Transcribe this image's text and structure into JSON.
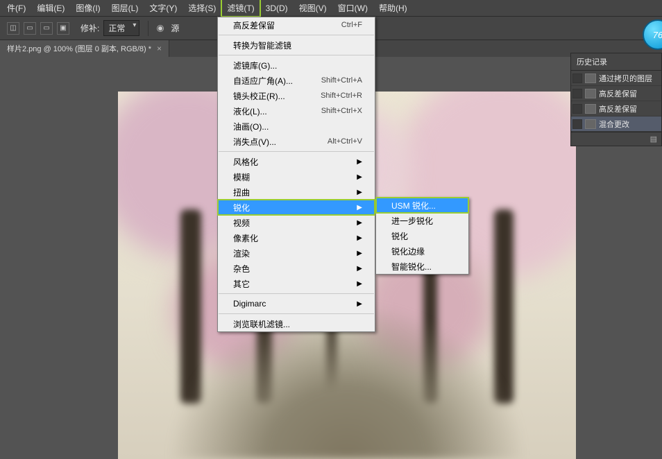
{
  "menubar": {
    "items": [
      {
        "label": "件(F)"
      },
      {
        "label": "编辑(E)"
      },
      {
        "label": "图像(I)"
      },
      {
        "label": "图层(L)"
      },
      {
        "label": "文字(Y)"
      },
      {
        "label": "选择(S)"
      },
      {
        "label": "滤镜(T)"
      },
      {
        "label": "3D(D)"
      },
      {
        "label": "视图(V)"
      },
      {
        "label": "窗口(W)"
      },
      {
        "label": "帮助(H)"
      }
    ],
    "active_index": 6
  },
  "optbar": {
    "label1": "修补:",
    "mode_value": "正常",
    "radio_label": "源"
  },
  "doc_tab": {
    "title": "样片2.png @ 100% (图层 0 副本, RGB/8) *"
  },
  "filter_menu": {
    "groups": [
      [
        {
          "label": "高反差保留",
          "shortcut": "Ctrl+F"
        }
      ],
      [
        {
          "label": "转换为智能滤镜"
        }
      ],
      [
        {
          "label": "滤镜库(G)..."
        },
        {
          "label": "自适应广角(A)...",
          "shortcut": "Shift+Ctrl+A"
        },
        {
          "label": "镜头校正(R)...",
          "shortcut": "Shift+Ctrl+R"
        },
        {
          "label": "液化(L)...",
          "shortcut": "Shift+Ctrl+X"
        },
        {
          "label": "油画(O)..."
        },
        {
          "label": "消失点(V)...",
          "shortcut": "Alt+Ctrl+V"
        }
      ],
      [
        {
          "label": "风格化",
          "submenu": true
        },
        {
          "label": "模糊",
          "submenu": true
        },
        {
          "label": "扭曲",
          "submenu": true
        },
        {
          "label": "锐化",
          "submenu": true
        },
        {
          "label": "视频",
          "submenu": true
        },
        {
          "label": "像素化",
          "submenu": true
        },
        {
          "label": "渲染",
          "submenu": true
        },
        {
          "label": "杂色",
          "submenu": true
        },
        {
          "label": "其它",
          "submenu": true
        }
      ],
      [
        {
          "label": "Digimarc",
          "submenu": true
        }
      ],
      [
        {
          "label": "浏览联机滤镜..."
        }
      ]
    ],
    "highlight_label": "锐化"
  },
  "sharpen_submenu": {
    "items": [
      {
        "label": "USM 锐化..."
      },
      {
        "label": "进一步锐化"
      },
      {
        "label": "锐化"
      },
      {
        "label": "锐化边缘"
      },
      {
        "label": "智能锐化..."
      }
    ],
    "highlight_index": 0
  },
  "history_panel": {
    "title": "历史记录",
    "rows": [
      {
        "label": "通过拷贝的图层"
      },
      {
        "label": "高反差保留"
      },
      {
        "label": "高反差保留"
      },
      {
        "label": "混合更改"
      }
    ],
    "selected_index": 3
  },
  "badge": {
    "text": "76"
  }
}
